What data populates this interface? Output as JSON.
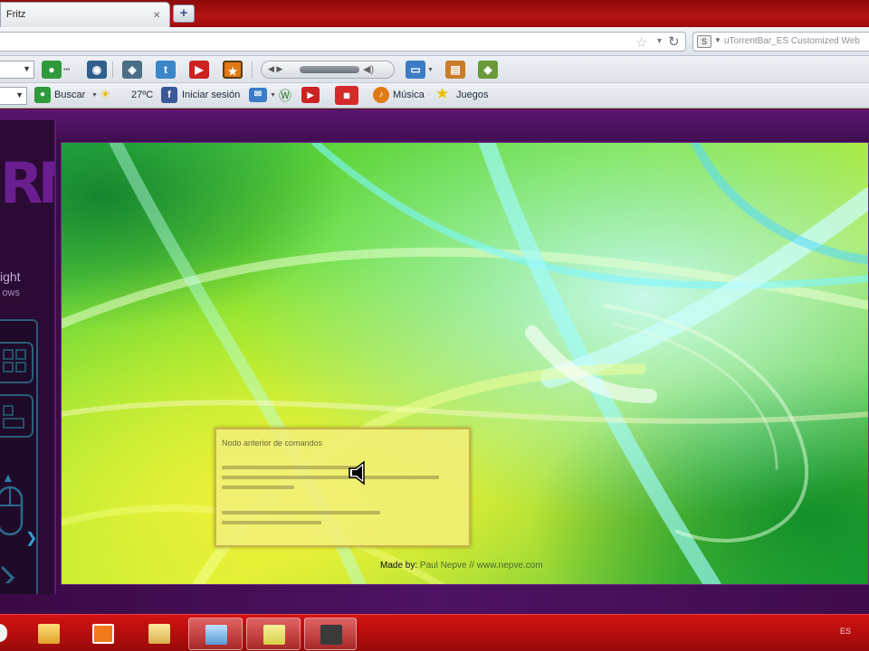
{
  "browser": {
    "tab": {
      "title": "Fritz",
      "new_tab_symbol": "+"
    },
    "search": {
      "placeholder": "uTorrentBar_ES Customized Web"
    },
    "toolbar2": {
      "search_label": "Buscar",
      "weather": "27ºC",
      "login_label": "Iniciar sesión",
      "music_label": "Música",
      "games_label": "Juegos"
    }
  },
  "note": {
    "title": "Nodo anterior de comandos"
  },
  "credit": {
    "prefix": "Made by:",
    "author": "Paul Nepve",
    "site": "www.nepve.com"
  },
  "taskbar": {
    "language": "ES"
  },
  "left_panel": {
    "word1": "ight",
    "word2": "ows"
  },
  "colors": {
    "titlebar": "#b51313",
    "page_bg": "#4d1263",
    "taskbar": "#c21010",
    "note_bg": "#f0ee78"
  }
}
